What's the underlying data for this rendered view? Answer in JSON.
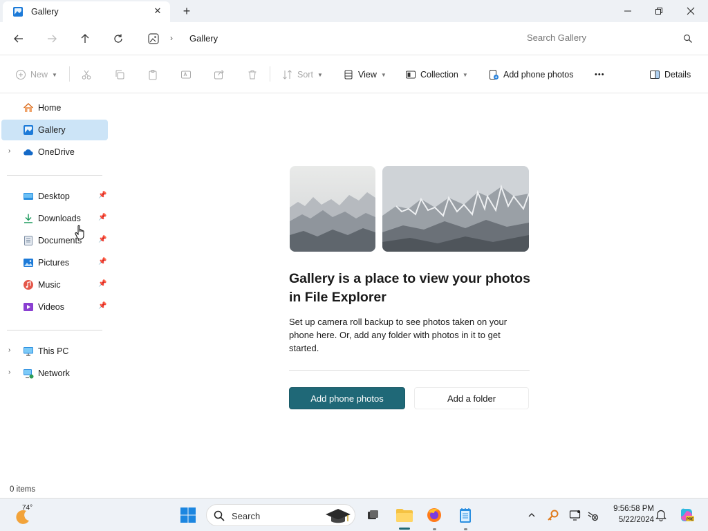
{
  "window": {
    "tab_title": "Gallery",
    "newtab_glyph": "+",
    "close_glyph": "✕"
  },
  "address": {
    "crumb": "Gallery",
    "separator": "›",
    "search_placeholder": "Search Gallery"
  },
  "commands": {
    "new": "New",
    "sort": "Sort",
    "view": "View",
    "collection": "Collection",
    "add_phone_photos": "Add phone photos",
    "more": "•••",
    "details": "Details"
  },
  "sidebar": {
    "items": [
      {
        "label": "Home",
        "icon": "home-icon"
      },
      {
        "label": "Gallery",
        "icon": "gallery-icon",
        "selected": true
      },
      {
        "label": "OneDrive",
        "icon": "onedrive-icon",
        "expandable": true
      },
      {
        "label": "Desktop",
        "icon": "desktop-icon",
        "pinned": true
      },
      {
        "label": "Downloads",
        "icon": "downloads-icon",
        "pinned": true
      },
      {
        "label": "Documents",
        "icon": "documents-icon",
        "pinned": true
      },
      {
        "label": "Pictures",
        "icon": "pictures-icon",
        "pinned": true
      },
      {
        "label": "Music",
        "icon": "music-icon",
        "pinned": true
      },
      {
        "label": "Videos",
        "icon": "videos-icon",
        "pinned": true
      },
      {
        "label": "This PC",
        "icon": "this-pc-icon",
        "expandable": true
      },
      {
        "label": "Network",
        "icon": "network-icon",
        "expandable": true
      }
    ],
    "expand_glyph": "›",
    "pin_glyph": "📌"
  },
  "main": {
    "heading": "Gallery is a place to view your photos in File Explorer",
    "description": "Set up camera roll backup to see photos taken on your phone here. Or, add any folder with photos in it to get started.",
    "primary_button": "Add phone photos",
    "secondary_button": "Add a folder"
  },
  "status": {
    "items": "0 items"
  },
  "taskbar": {
    "weather_temp": "74°",
    "search_label": "Search",
    "time": "9:56:58 PM",
    "date": "5/22/2024",
    "accent": "#1f6877"
  }
}
